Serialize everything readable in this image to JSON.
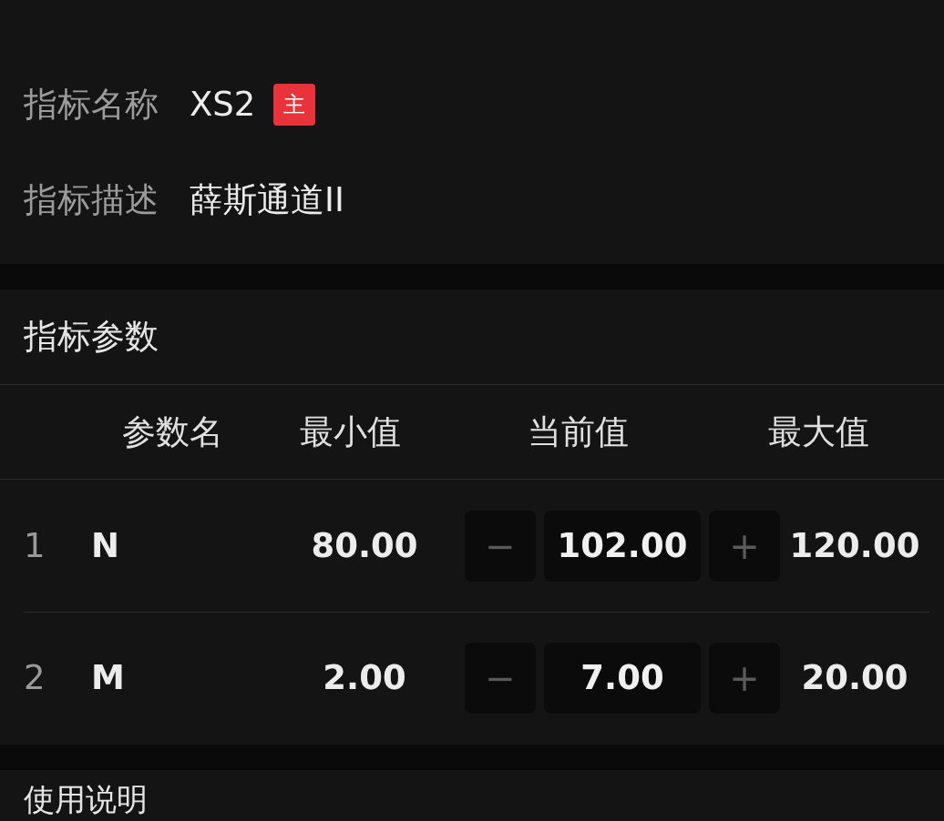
{
  "info": [
    {
      "label": "指标名称",
      "value": "XS2",
      "badge": "主"
    },
    {
      "label": "指标描述",
      "value": "薛斯通道II"
    }
  ],
  "params_section": {
    "title": "指标参数",
    "columns": [
      "参数名",
      "最小值",
      "当前值",
      "最大值"
    ],
    "rows": [
      {
        "index": "1",
        "name": "N",
        "min": "80.00",
        "value": "102.00",
        "max": "120.00",
        "minus": "−",
        "plus": "+"
      },
      {
        "index": "2",
        "name": "M",
        "min": "2.00",
        "value": "7.00",
        "max": "20.00",
        "minus": "−",
        "plus": "+"
      }
    ]
  },
  "usage_section": {
    "title": "使用说明"
  }
}
